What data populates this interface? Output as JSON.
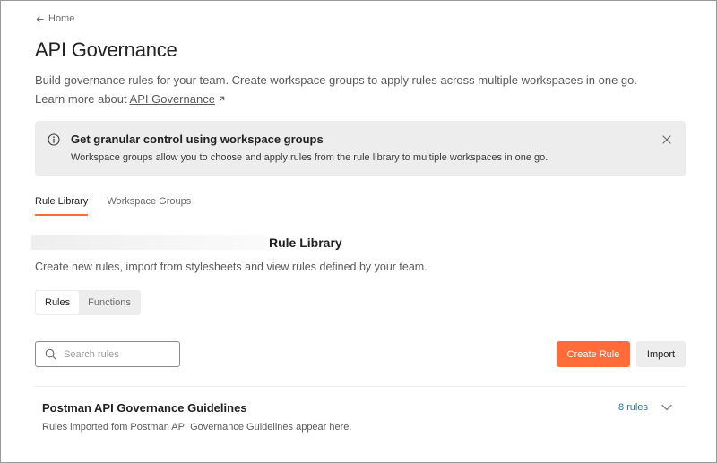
{
  "nav": {
    "back_label": "Home"
  },
  "header": {
    "title": "API Governance",
    "description": "Build governance rules for your team. Create workspace groups to apply rules across multiple workspaces in one go.",
    "learn_prefix": "Learn more about ",
    "learn_link": "API Governance"
  },
  "banner": {
    "title": "Get granular control using workspace groups",
    "text": "Workspace groups allow you to choose and apply rules from the rule library to multiple workspaces in one go."
  },
  "tabs": [
    {
      "label": "Rule Library",
      "active": true
    },
    {
      "label": "Workspace Groups",
      "active": false
    }
  ],
  "section": {
    "title": "Rule Library",
    "description": "Create new rules, import from stylesheets and view rules defined by your team."
  },
  "segments": [
    {
      "label": "Rules",
      "active": true
    },
    {
      "label": "Functions",
      "active": false
    }
  ],
  "search": {
    "placeholder": "Search rules",
    "value": ""
  },
  "actions": {
    "create_label": "Create Rule",
    "import_label": "Import"
  },
  "rule_group": {
    "title": "Postman API Governance Guidelines",
    "description": "Rules imported fom Postman API Governance Guidelines appear here.",
    "count_label": "8 rules"
  },
  "colors": {
    "accent": "#ff6c37",
    "link": "#2470b3",
    "banner_bg": "#ededed"
  },
  "icons": [
    "arrow-left-icon",
    "external-link-icon",
    "info-icon",
    "close-icon",
    "search-icon",
    "chevron-down-icon"
  ]
}
